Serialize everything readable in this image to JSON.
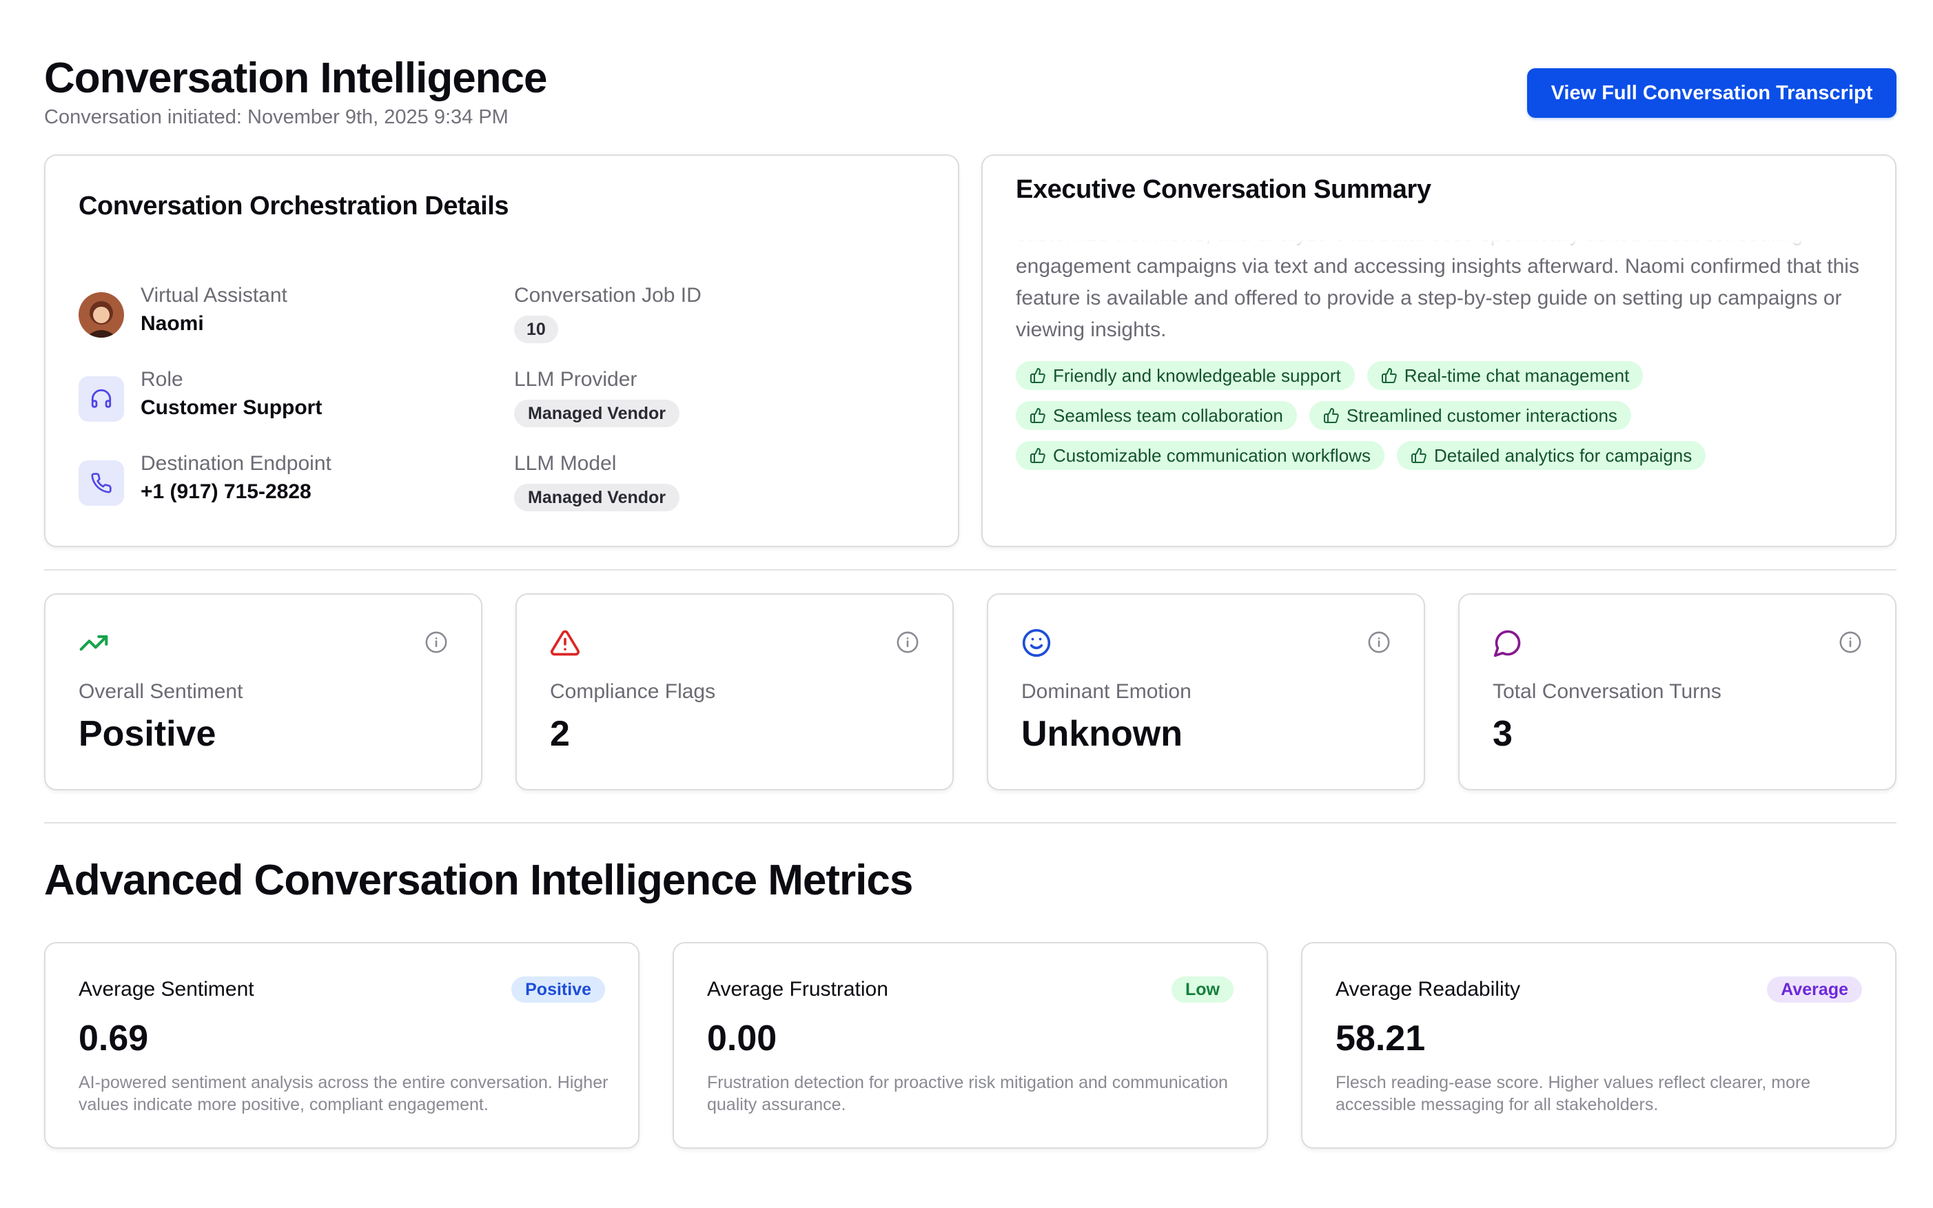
{
  "header": {
    "title": "Conversation Intelligence",
    "subtitle": "Conversation initiated: November 9th, 2025 9:34 PM",
    "transcript_button": "View Full Conversation Transcript"
  },
  "orchestration": {
    "title": "Conversation Orchestration Details",
    "assistant_label": "Virtual Assistant",
    "assistant_value": "Naomi",
    "job_label": "Conversation Job ID",
    "job_value": "10",
    "role_label": "Role",
    "role_value": "Customer Support",
    "provider_label": "LLM Provider",
    "provider_value": "Managed Vendor",
    "endpoint_label": "Destination Endpoint",
    "endpoint_value": "+1 (917) 715-2828",
    "model_label": "LLM Model",
    "model_value": "Managed Vendor"
  },
  "summary": {
    "title": "Executive Conversation Summary",
    "text": "customize workflows, and analyze chat data. Jose specifically asked about scheduling engagement campaigns via text and accessing insights afterward. Naomi confirmed that this feature is available and offered to provide a step-by-step guide on setting up campaigns or viewing insights.",
    "tags": [
      "Friendly and knowledgeable support",
      "Real-time chat management",
      "Seamless team collaboration",
      "Streamlined customer interactions",
      "Customizable communication workflows",
      "Detailed analytics for campaigns"
    ]
  },
  "stats": [
    {
      "label": "Overall Sentiment",
      "value": "Positive",
      "icon": "trending-up-icon",
      "color": "#16a34a"
    },
    {
      "label": "Compliance Flags",
      "value": "2",
      "icon": "warning-triangle-icon",
      "color": "#dc2626"
    },
    {
      "label": "Dominant Emotion",
      "value": "Unknown",
      "icon": "smile-icon",
      "color": "#1d4ed8"
    },
    {
      "label": "Total Conversation Turns",
      "value": "3",
      "icon": "chat-bubble-icon",
      "color": "#86198f"
    }
  ],
  "metrics_title": "Advanced Conversation Intelligence Metrics",
  "metrics": [
    {
      "label": "Average Sentiment",
      "badge": "Positive",
      "value": "0.69",
      "description": "AI-powered sentiment analysis across the entire conversation. Higher values indicate more positive, compliant engagement.",
      "badge_bg": "#dbeafe",
      "badge_fg": "#1d4ed8"
    },
    {
      "label": "Average Frustration",
      "badge": "Low",
      "value": "0.00",
      "description": "Frustration detection for proactive risk mitigation and communication quality assurance.",
      "badge_bg": "#dcfce4",
      "badge_fg": "#15803d"
    },
    {
      "label": "Average Readability",
      "badge": "Average",
      "value": "58.21",
      "description": "Flesch reading-ease score. Higher values reflect clearer, more accessible messaging for all stakeholders.",
      "badge_bg": "#ede4fb",
      "badge_fg": "#6d28d9"
    }
  ]
}
